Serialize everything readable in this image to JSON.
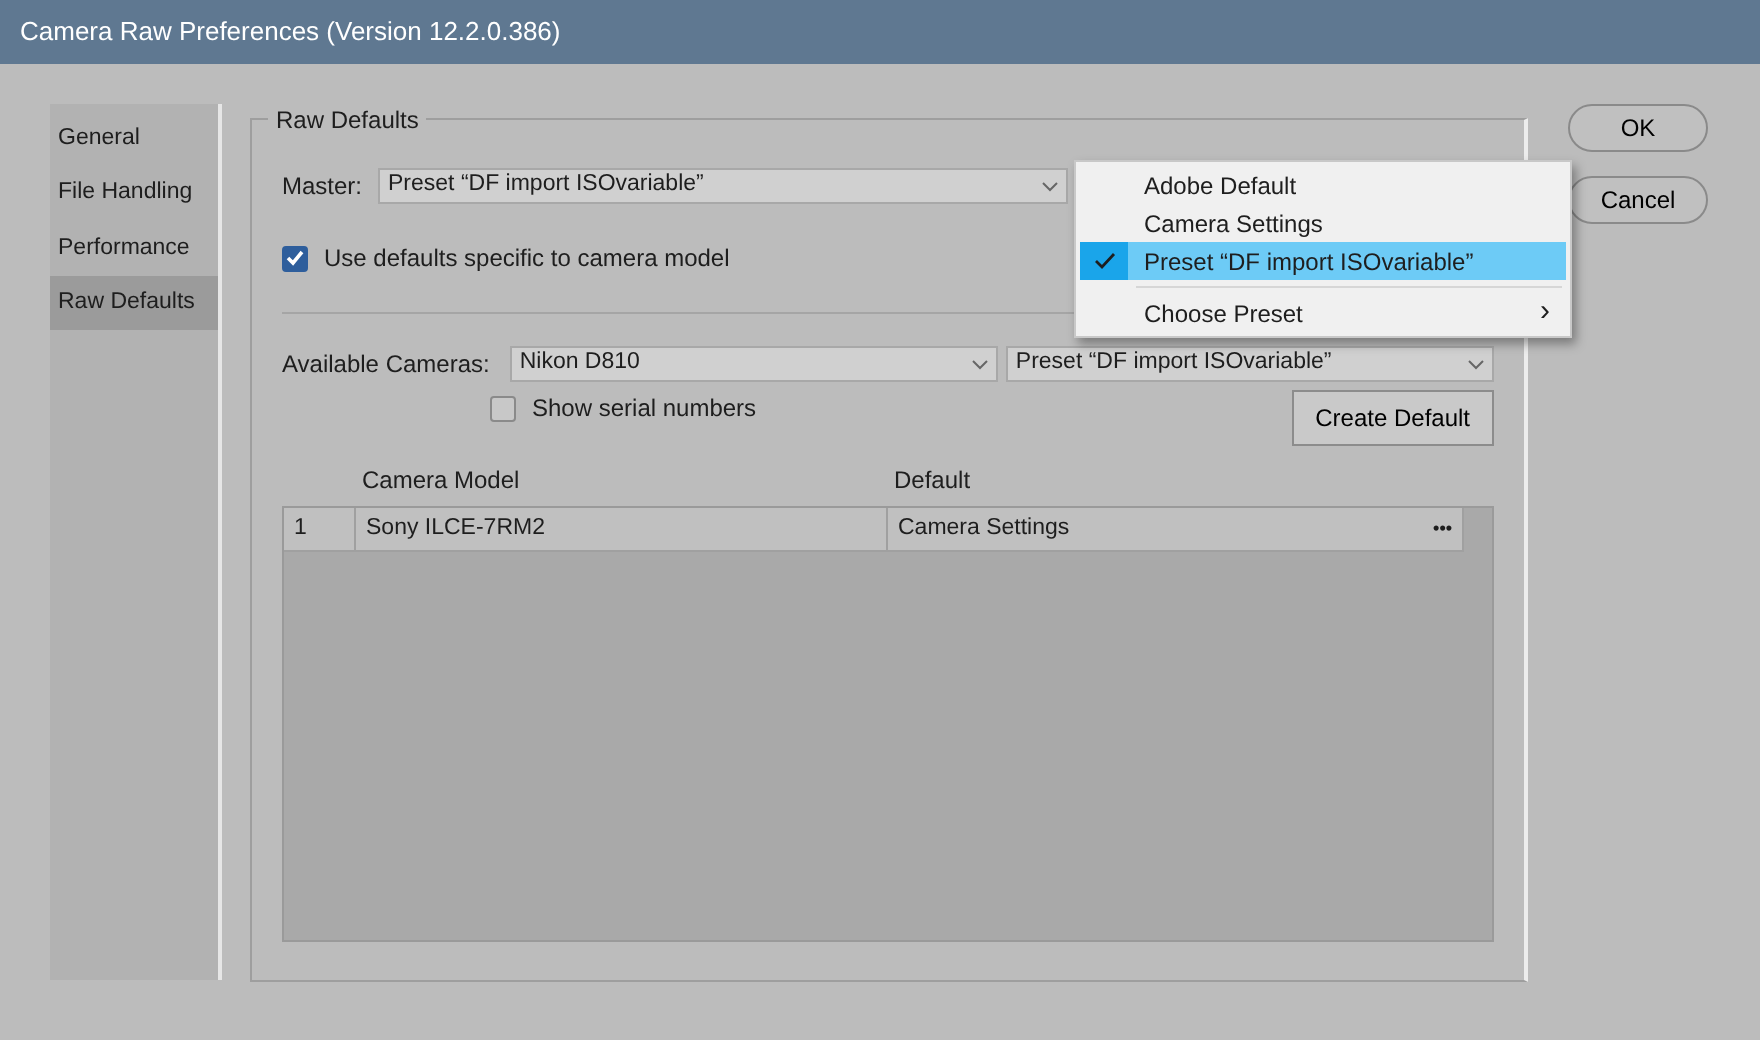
{
  "window": {
    "title": "Camera Raw Preferences  (Version 12.2.0.386)"
  },
  "sidebar": {
    "items": [
      {
        "label": "General",
        "selected": false
      },
      {
        "label": "File Handling",
        "selected": false
      },
      {
        "label": "Performance",
        "selected": false
      },
      {
        "label": "Raw Defaults",
        "selected": true
      }
    ]
  },
  "raw_defaults": {
    "title": "Raw Defaults",
    "master": {
      "label": "Master:",
      "value": "Preset “DF import ISOvariable”"
    },
    "camera_specific": {
      "label": "Use defaults specific to camera model",
      "checked": true
    },
    "available_cameras": {
      "label": "Available Cameras:",
      "value": "Nikon D810",
      "preset_value": "Preset “DF import ISOvariable”"
    },
    "show_serial": {
      "label": "Show serial numbers",
      "checked": false
    },
    "create_button": "Create Default",
    "table": {
      "columns": [
        "Camera Model",
        "Default"
      ],
      "rows": [
        {
          "index": "1",
          "model": "Sony ILCE-7RM2",
          "default": "Camera Settings",
          "more": "•••"
        }
      ]
    }
  },
  "buttons": [
    "OK",
    "Cancel"
  ],
  "dropdown_menu": {
    "items": [
      {
        "kind": "item",
        "label": "Adobe Default",
        "selected": false
      },
      {
        "kind": "item",
        "label": "Camera Settings",
        "selected": false
      },
      {
        "kind": "item",
        "label": "Preset “DF import ISOvariable”",
        "selected": true
      },
      {
        "kind": "submenu",
        "label": "Choose Preset",
        "selected": false,
        "arrow": "›"
      }
    ]
  }
}
